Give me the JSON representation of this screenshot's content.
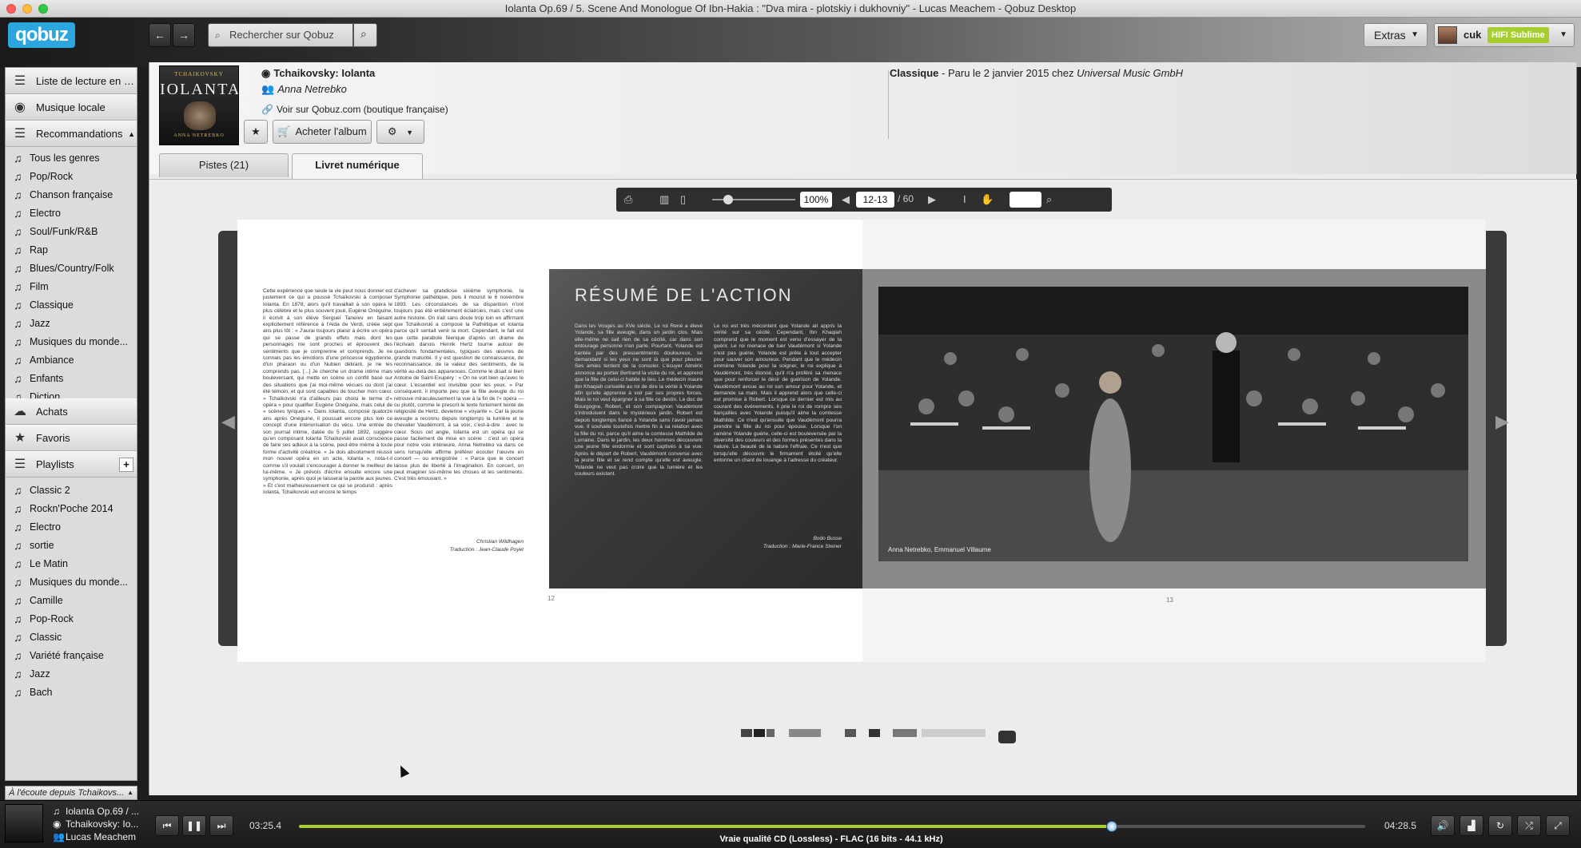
{
  "window": {
    "title": "Iolanta Op.69 / 5. Scene And Monologue Of Ibn-Hakia : \"Dva mira - plotskiy i dukhovniy\" - Lucas Meachem - Qobuz Desktop"
  },
  "toolbar": {
    "logo": "qobuz",
    "search_placeholder": "Rechercher sur Qobuz",
    "extras_label": "Extras",
    "user_name": "cuk",
    "subscription_badge": "HIFI Sublime"
  },
  "sidebar": {
    "sections_top": [
      {
        "label": "Liste de lecture en co...",
        "icon": "list-icon"
      },
      {
        "label": "Musique locale",
        "icon": "disc-icon"
      },
      {
        "label": "Recommandations",
        "icon": "list-icon"
      }
    ],
    "genres": [
      "Tous les genres",
      "Pop/Rock",
      "Chanson française",
      "Electro",
      "Soul/Funk/R&B",
      "Rap",
      "Blues/Country/Folk",
      "Film",
      "Classique",
      "Jazz",
      "Musiques du monde...",
      "Ambiance",
      "Enfants",
      "Diction"
    ],
    "sections_mid": [
      {
        "label": "Achats",
        "icon": "cloud-icon"
      },
      {
        "label": "Favoris",
        "icon": "star-icon"
      },
      {
        "label": "Playlists",
        "icon": "list-icon"
      }
    ],
    "playlists": [
      "Classic 2",
      "Rockn'Poche 2014",
      "Electro",
      "sortie",
      "Le Matin",
      "Musiques du monde...",
      "Camille",
      "Pop-Rock",
      "Classic",
      "Variété française",
      "Jazz",
      "Bach"
    ],
    "now_listening": "À l'écoute depuis Tchaikovs..."
  },
  "album": {
    "title": "Tchaikovsky: Iolanta",
    "artist": "Anna Netrebko",
    "shop_link": "Voir sur Qobuz.com (boutique française)",
    "buy_label": "Acheter l'album",
    "genre": "Classique",
    "release_info": " - Paru le 2 janvier 2015 chez ",
    "label": "Universal Music GmbH",
    "cover_lines": [
      "TCHAIKOVSKY",
      "IOLANTA",
      "ANNA NETREBKO"
    ]
  },
  "tabs": [
    {
      "label": "Pistes (21)",
      "active": false
    },
    {
      "label": "Livret numérique",
      "active": true
    }
  ],
  "reader": {
    "zoom": "100%",
    "page": "12-13",
    "total_pages": "/ 60"
  },
  "booklet": {
    "left_col1": "Cette expérience que seule la vie peut nous donner est justement ce qui a poussé Tchaïkovski à composer Iolanta. En 1878, alors qu'il travaillait à son opéra le plus célèbre et le plus souvent joué, Eugène Onéguine, il écrivit à son élève Sergueï Taneïev en faisant explicitement référence à l'Aida de Verdi, créée sept ans plus tôt : « J'aurai toujours plaisir à écrire un opéra qui se passe de grands effets mais dont les personnages me sont proches et éprouvent des sentiments que je comprenne et comprends. Je ne connais pas les émotions d'une princesse égyptienne, d'un pharaon ou d'un Nubien délirant, je ne les comprends pas. [...] Je cherche un drame intime mais bouleversant, qui mette en scène un conflit basé sur des situations que j'ai moi-même vécues ou dont j'ai été témoin, et qui sont capables de toucher mon cœur. » Tchaïkovski n'a d'ailleurs pas choisi le terme d'« opéra » pour qualifier Eugène Onéguine, mais celui de « scènes lyriques ». Dans Iolanta, composé quatorze ans après Onéguine, il poussait encore plus loin ce concept d'une intériorisation du vécu. Une entrée de son journal intime, datée du 5 juillet 1892, suggère qu'en composant Iolanta Tchaïkovski avait conscience de faire ses adieux à la scène, peut-être même à toute forme d'activité créatrice. « Je dois absolument réussir mon nouvel opéra en un acte, Iolanta », nota-t-il comme s'il voulait s'encourager à donner le meilleur de lui-même. « Je prévois d'écrire ensuite encore une symphonie, après quoi je laisserai la parole aux jeunes. » Et c'est malheureusement ce qui se produisit : après Iolanta, Tchaïkovski eut encore le temps",
    "left_col2": "d'achever sa grandiose sixième symphonie, la Symphonie pathétique, puis il mourut le 6 novembre 1893. Les circonstances de sa disparition n'ont toujours pas été entièrement éclaircies, mais c'est une autre histoire. On irait sans doute trop loin en affirmant que Tchaïkovski a composé la Pathétique et Iolanta parce qu'il sentait venir la mort. Cependant, le fait est que cette parabole féerique d'après un drame de l'écrivain danois Henrik Hertz tourne autour de questions fondamentales, typiques des œuvres de grande maturité. Il y est question de connaissance, de reconnaissance, de la valeur des sentiments, de la vérité au-delà des apparences. Comme le disait si bien Antoine de Saint-Exupéry : « On ne voit bien qu'avec le cœur. L'essentiel est invisible pour les yeux. » Par conséquent, il importe peu que la fille aveugle du roi retrouve miraculeusement la vue à la fin de l'« opéra — ou plutôt, comme le prescrit le texte fortement teinté de religiosité de Hertz, devienne « voyante ». Car la jeune aveugle a reconnu depuis longtemps la lumière et le chevalier Vaudémont, à sa voix, c'est-à-dire : avec le cœur. Sous cet angle, Iolanta est un opéra qui se passe facilement de mise en scène : c'est un opéra pour notre voix intérieure. Anna Netrebko va dans ce sens lorsqu'elle affirme préférer écouter l'œuvre en concert — ou enregistrée : « Parce que le concert laisse plus de liberté à l'imagination. En concert, on peut imaginer soi-même les choses et les sentiments. C'est très émouvant. »",
    "left_col2_sign1": "Christian Wildhagen",
    "left_col2_sign2": "Traduction : Jean-Claude Poyet",
    "resume_heading": "RÉSUMÉ DE L'ACTION",
    "dark_col1": "Dans les Vosges au XVe siècle. Le roi René a élevé Yolande, sa fille aveugle, dans un jardin clos. Mais elle-même ne sait rien de sa cécité, car dans son entourage personne n'en parle. Pourtant, Yolande est hantée par des pressentiments douloureux, se demandant si les yeux ne sont là que pour pleurer. Ses amies tentent de la consoler. L'écuyer Alméric annonce au portier Bertrand la visite du roi, et apprend que la fille de celui-ci habite le lieu. Le médecin maure Ibn Khaqiah conseille au roi de dire la vérité à Yolande afin qu'elle apprenne à voir par ses propres forces. Mais le roi veut épargner à sa fille ce destin. Le duc de Bourgogne, Robert, et son compagnon Vaudémont s'introduisent dans le mystérieux jardin. Robert est depuis longtemps fiancé à Yolande sans l'avoir jamais vue. Il souhaite toutefois mettre fin à sa relation avec la fille du roi, parce qu'il aime la comtesse Mathilde de Lorraine. Dans le jardin, les deux hommes découvrent une jeune fille endormie et sont captivés à sa vue. Après le départ de Robert, Vaudémont converse avec la jeune fille et se rend compte qu'elle est aveugle. Yolande ne veut pas croire que la lumière et les couleurs existent.",
    "dark_col2": "Le roi est très mécontent que Yolande ait appris la vérité sur sa cécité. Cependant, Ibn Khaqiah comprend que le moment est venu d'essayer de la guérir. Le roi menace de tuer Vaudémont si Yolande n'est pas guérie. Yolande est prête à tout accepter pour sauver son amoureux. Pendant que le médecin emmène Yolande pour la soigner, le roi explique à Vaudémont, très étonné, qu'il n'a proféré sa menace que pour renforcer le désir de guérison de Yolande. Vaudémont avoue au roi son amour pour Yolande, et demande sa main. Mais il apprend alors que celle-ci est promise à Robert. Lorsque ce dernier est mis au courant des événements, il prie le roi de rompre ses fiançailles avec Yolande puisqu'il aime la comtesse Mathilde. Ce n'est qu'ensuite que Vaudémont pourra prendre la fille du roi pour épouse. Lorsque l'on ramène Yolande guérie, celle-ci est bouleversée par la diversité des couleurs et des formes présentes dans la nature. La beauté de la nature l'effraie. Ce n'est que lorsqu'elle découvre le firmament étoilé qu'elle entonne un chant de louange à l'adresse du créateur.",
    "dark_sign1": "Bodo Busse",
    "dark_sign2": "Traduction : Marie-France Steiner",
    "photo_caption": "Anna Netrebko, Emmanuel Villaume",
    "page_left_num": "12",
    "page_right_num": "13"
  },
  "player": {
    "track": "Iolanta Op.69 / ...",
    "album": "Tchaikovsky: Io...",
    "artist": "Lucas Meachem",
    "time_current": "03:25.4",
    "time_total": "04:28.5",
    "progress": 0.762,
    "quality": "Vraie qualité CD (Lossless) - FLAC (16 bits - 44.1 kHz)"
  },
  "colors": {
    "accent": "#2ba6df",
    "progress": "#a6cf2e",
    "badge": "#a6cf2e"
  }
}
